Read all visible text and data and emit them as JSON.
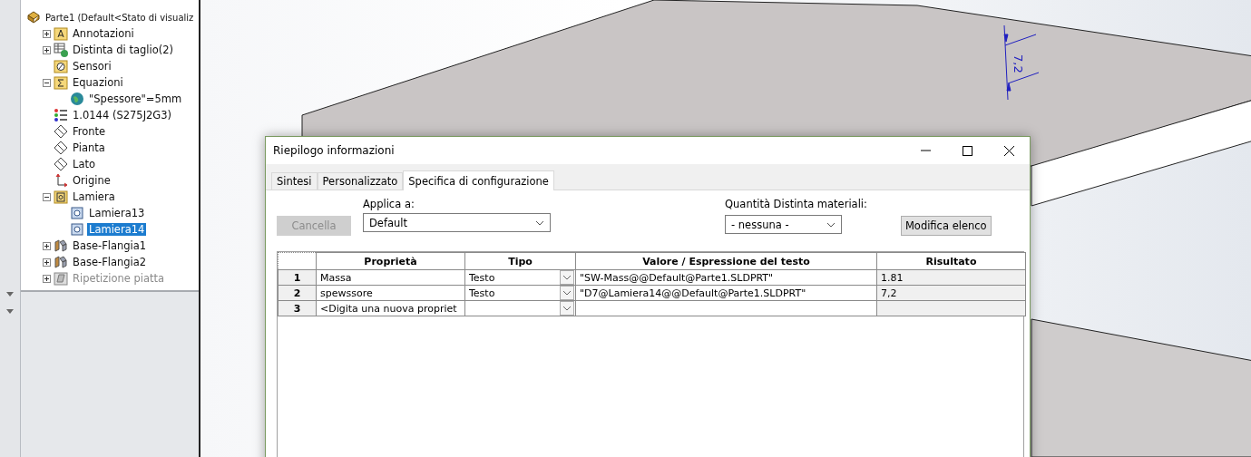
{
  "tree": {
    "root": {
      "label": "Parte1  (Default<Stato di visualiz",
      "kind": "part"
    },
    "items": [
      {
        "label": "Annotazioni",
        "kind": "annotations",
        "expanded": false,
        "selected": false,
        "disabled": false
      },
      {
        "label": "Distinta di taglio(2)",
        "kind": "cutlist",
        "expanded": false,
        "selected": false,
        "disabled": false
      },
      {
        "label": "Sensori",
        "kind": "sensors",
        "selected": false,
        "disabled": false
      },
      {
        "label": "Equazioni",
        "kind": "equations",
        "expanded": true,
        "selected": false,
        "disabled": false,
        "children": [
          {
            "label": "\"Spessore\"=5mm",
            "kind": "globe",
            "selected": false,
            "disabled": false
          }
        ]
      },
      {
        "label": "1.0144 (S275J2G3)",
        "kind": "material",
        "selected": false,
        "disabled": false
      },
      {
        "label": "Fronte",
        "kind": "plane",
        "selected": false,
        "disabled": false
      },
      {
        "label": "Pianta",
        "kind": "plane",
        "selected": false,
        "disabled": false
      },
      {
        "label": "Lato",
        "kind": "plane",
        "selected": false,
        "disabled": false
      },
      {
        "label": "Origine",
        "kind": "origin",
        "selected": false,
        "disabled": false
      },
      {
        "label": "Lamiera",
        "kind": "sheetmetal",
        "expanded": true,
        "selected": false,
        "disabled": false,
        "children": [
          {
            "label": "Lamiera13",
            "kind": "sheetfeature",
            "selected": false,
            "disabled": false
          },
          {
            "label": "Lamiera14",
            "kind": "sheetfeature",
            "selected": true,
            "disabled": false
          }
        ]
      },
      {
        "label": "Base-Flangia1",
        "kind": "flange",
        "expanded": false,
        "selected": false,
        "disabled": false
      },
      {
        "label": "Base-Flangia2",
        "kind": "flange",
        "expanded": false,
        "selected": false,
        "disabled": false
      },
      {
        "label": "Ripetizione piatta",
        "kind": "flatpattern",
        "expanded": false,
        "selected": false,
        "disabled": true
      }
    ]
  },
  "viewport": {
    "dimension_label": "7,2"
  },
  "dialog": {
    "title": "Riepilogo informazioni",
    "tabs": [
      {
        "label": "Sintesi",
        "selected": false
      },
      {
        "label": "Personalizzato",
        "selected": false
      },
      {
        "label": "Specifica di configurazione",
        "selected": true
      }
    ],
    "apply_label": "Applica a:",
    "cancel_button": {
      "label": "Cancella",
      "disabled": true
    },
    "apply_value": "Default",
    "bom_label": "Quantità Distinta materiali:",
    "bom_value": "- nessuna -",
    "edit_button": "Modifica elenco",
    "table": {
      "columns": [
        "Proprietà",
        "Tipo",
        "Valore / Espressione del testo",
        "Risultato"
      ],
      "rows": [
        {
          "number": "1",
          "property": "Massa",
          "type": "Testo",
          "value": "\"SW-Mass@@Default@Parte1.SLDPRT\"",
          "result": "1.81"
        },
        {
          "number": "2",
          "property": "spewssore",
          "type": "Testo",
          "value": "\"D7@Lamiera14@@Default@Parte1.SLDPRT\"",
          "result": "7,2"
        },
        {
          "number": "3",
          "property": "<Digita una nuova propriet",
          "type": "",
          "value": "",
          "result": ""
        }
      ]
    }
  }
}
